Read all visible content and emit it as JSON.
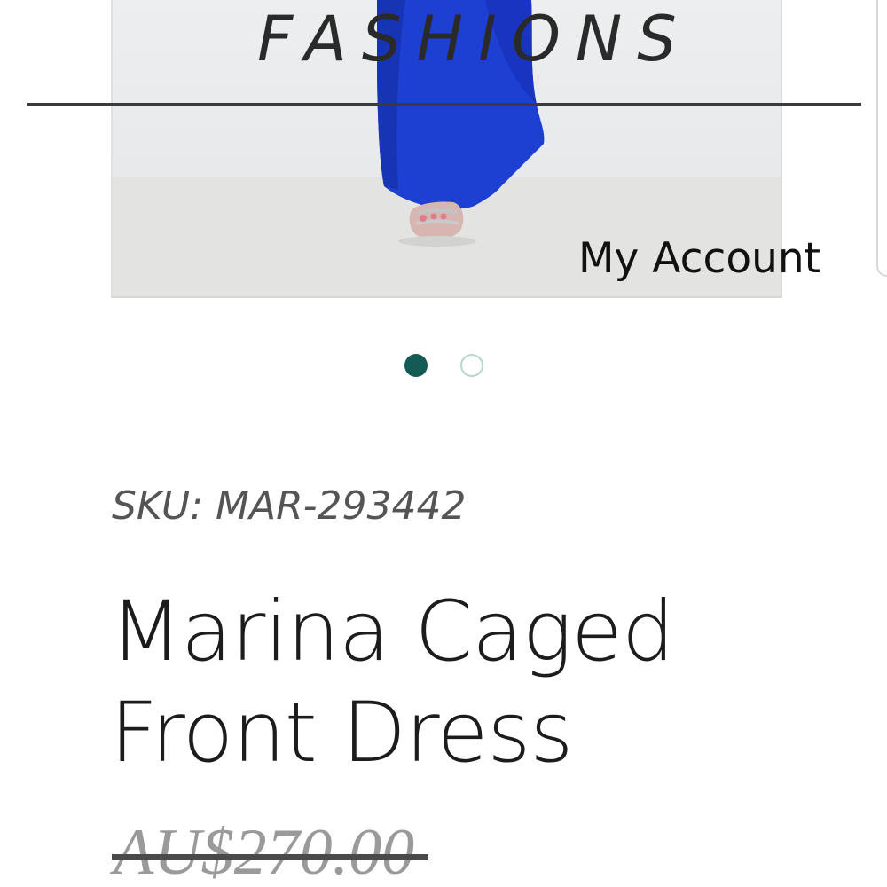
{
  "header": {
    "brand": "FASHIONS",
    "account_link": "My Account"
  },
  "gallery": {
    "image_icon": "product-photo-blue-dress",
    "slide_count": 2,
    "active_slide": 1
  },
  "product": {
    "sku": "SKU: MAR-293442",
    "title": "Marina Caged Front Dress",
    "original_price": "AU$270.00"
  },
  "colors": {
    "dress_blue": "#1f3fd6",
    "dot_active": "#145b56",
    "dot_inactive_border": "#b7d6d3",
    "text_dark": "#1c1c1c",
    "text_muted": "#555555",
    "price_muted": "#9a9a9a"
  }
}
